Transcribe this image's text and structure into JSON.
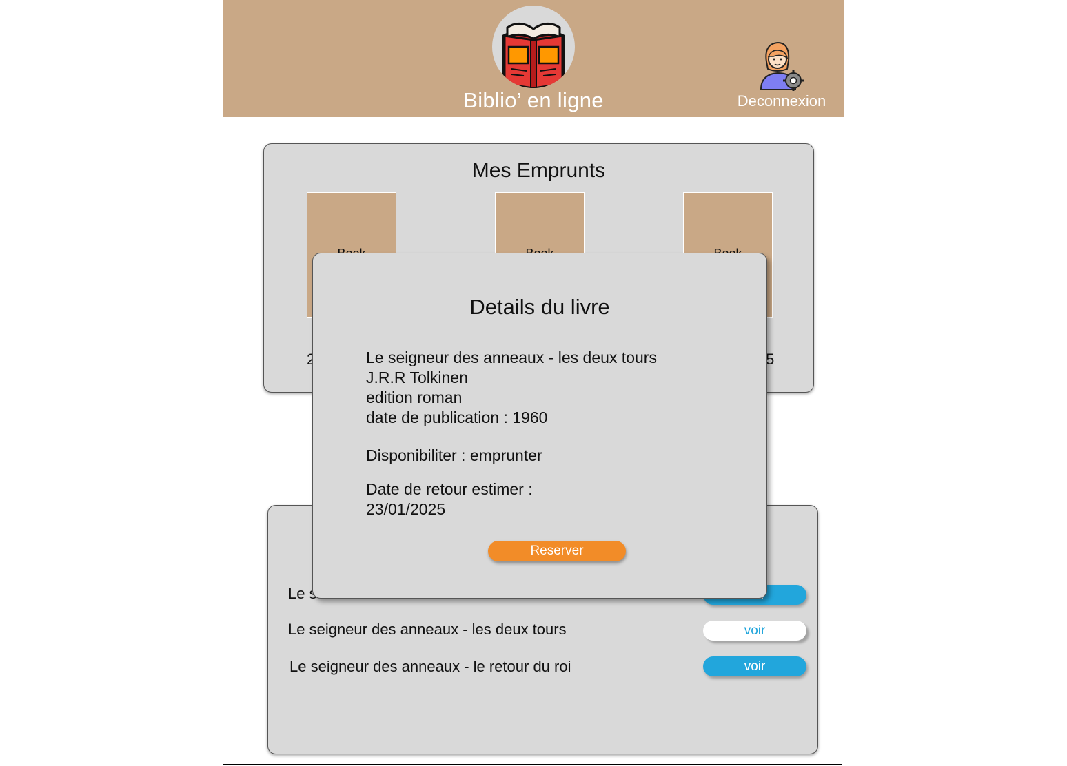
{
  "header": {
    "app_title": "Biblio’ en ligne",
    "logo_icon": "open-book-icon",
    "user_icon": "user-settings-icon",
    "logout_label": "Deconnexion",
    "background_color": "#c9a886"
  },
  "loans": {
    "title": "Mes Emprunts",
    "books": [
      {
        "cover_label": "Book",
        "date": "2"
      },
      {
        "cover_label": "Book",
        "date": ""
      },
      {
        "cover_label": "Book",
        "date": "5"
      }
    ]
  },
  "list": {
    "rows": [
      {
        "title": "Le s",
        "button": "voir",
        "selected": false
      },
      {
        "title": "Le seigneur des anneaux - les deux tours",
        "button": "voir",
        "selected": true
      },
      {
        "title": "Le seigneur des anneaux - le retour du roi",
        "button": "voir",
        "selected": false
      }
    ]
  },
  "modal": {
    "title": "Details du livre",
    "book_title": "Le seigneur des anneaux - les deux tours",
    "author": "J.R.R Tolkinen",
    "edition": "edition roman",
    "publication": "date de publication : 1960",
    "availability": "Disponibiliter :  emprunter",
    "return_label": "Date de retour estimer :",
    "return_date": "23/01/2025",
    "reserve_label": "Reserver"
  },
  "colors": {
    "accent_blue": "#22a6dc",
    "accent_orange": "#f28c28",
    "panel_gray": "#d9d9d9"
  }
}
